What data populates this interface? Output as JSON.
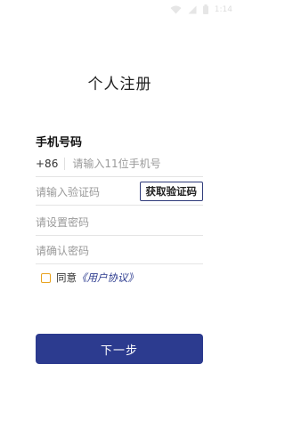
{
  "status_bar": {
    "time": "1:14",
    "icons": [
      "wifi-icon",
      "signal-icon",
      "battery-icon"
    ]
  },
  "page_title": "个人注册",
  "phone_section": {
    "label": "手机号码",
    "country_code": "+86",
    "placeholder": "请输入11位手机号"
  },
  "code_field": {
    "placeholder": "请输入验证码",
    "button_label": "获取验证码"
  },
  "password_field": {
    "placeholder": "请设置密码"
  },
  "confirm_field": {
    "placeholder": "请确认密码"
  },
  "agreement": {
    "checked": false,
    "text": "同意",
    "link_label": "《用户协议》"
  },
  "next_button": {
    "label": "下一步"
  },
  "colors": {
    "primary": "#2c3b8f",
    "checkbox_border": "#e8a21d",
    "placeholder": "#9a9a9a",
    "divider": "#e4e4e4"
  }
}
